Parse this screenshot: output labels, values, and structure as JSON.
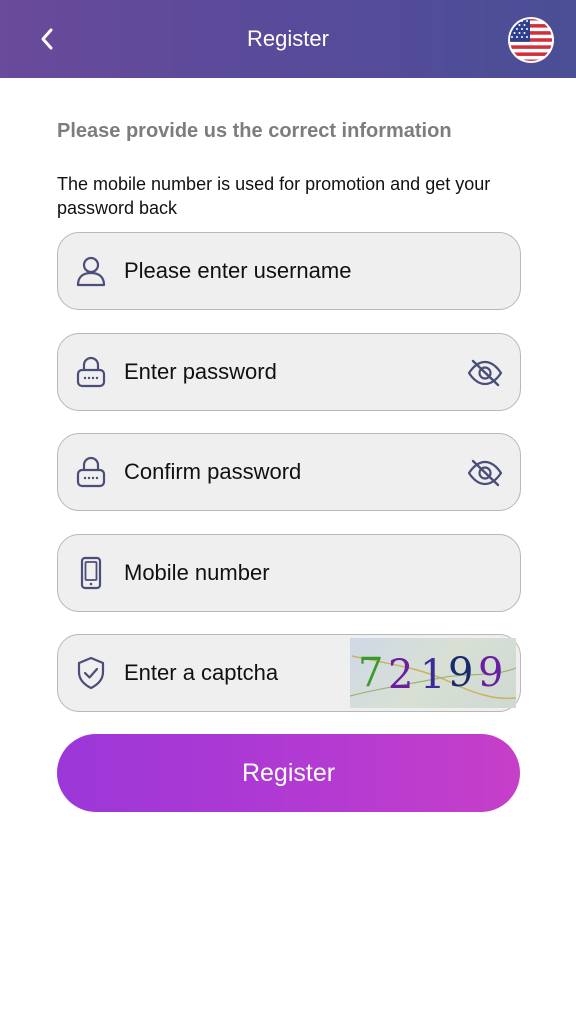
{
  "header": {
    "title": "Register",
    "back_icon": "chevron-left-icon",
    "flag_icon": "us-flag-icon"
  },
  "intro": {
    "title": "Please provide us the correct information",
    "description": "The mobile number is used for promotion and get your password back"
  },
  "form": {
    "username": {
      "placeholder": "Please enter username",
      "icon": "user-icon"
    },
    "password": {
      "placeholder": "Enter password",
      "icon": "lock-icon",
      "toggle_icon": "eye-off-icon"
    },
    "confirm_password": {
      "placeholder": "Confirm password",
      "icon": "lock-icon",
      "toggle_icon": "eye-off-icon"
    },
    "mobile": {
      "placeholder": "Mobile number",
      "icon": "phone-icon"
    },
    "captcha": {
      "placeholder": "Enter a captcha",
      "icon": "shield-check-icon",
      "code": "72199"
    }
  },
  "register_button": {
    "label": "Register"
  },
  "colors": {
    "header_start": "#6a4a9a",
    "header_end": "#4a4f96",
    "button_start": "#9b37d8",
    "button_end": "#c63fc8",
    "icon": "#4a4e78"
  }
}
